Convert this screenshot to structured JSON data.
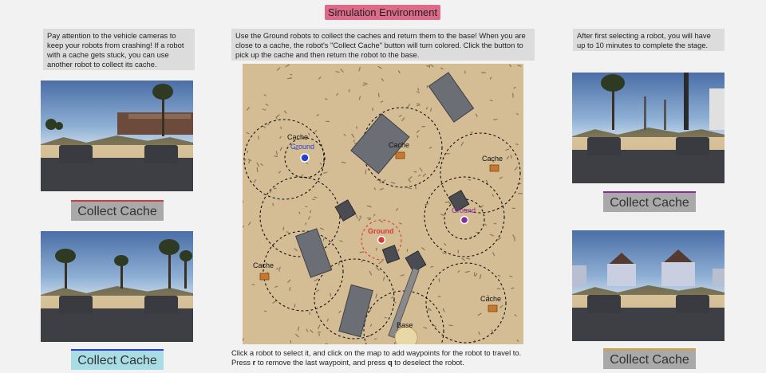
{
  "title": "Simulation Environment",
  "notes": {
    "left": "Pay attention to the vehicle cameras to keep your robots from crashing! If a robot with a cache gets stuck, you can use another robot to collect its cache.",
    "center": "Use the Ground robots to collect the caches and return them to the base! When you are close to a cache, the robot's \"Collect Cache\" button will turn colored. Click the button to pick up the cache and then return the robot to the base.",
    "right": "After first selecting a robot, you will have up to 10 minutes to complete the stage."
  },
  "cameras": [
    {
      "id": "red",
      "accent": "#d83a3a",
      "button_label": "Collect Cache",
      "active": false
    },
    {
      "id": "blue",
      "accent": "#2a3fd0",
      "button_label": "Collect Cache",
      "active": true
    },
    {
      "id": "purple",
      "accent": "#8a2a9a",
      "button_label": "Collect Cache",
      "active": false
    },
    {
      "id": "orange",
      "accent": "#d8a030",
      "button_label": "Collect Cache",
      "active": false
    }
  ],
  "map": {
    "labels": {
      "cache": "Cache",
      "ground": "Ground",
      "base": "Base"
    }
  },
  "footer": {
    "line1": "Click a robot to select it, and click on the map to add waypoints for the robot to travel to.",
    "line2_a": "Press ",
    "line2_r": "r",
    "line2_b": " to remove the last waypoint, and press ",
    "line2_q": "q",
    "line2_c": " to deselect the robot."
  }
}
